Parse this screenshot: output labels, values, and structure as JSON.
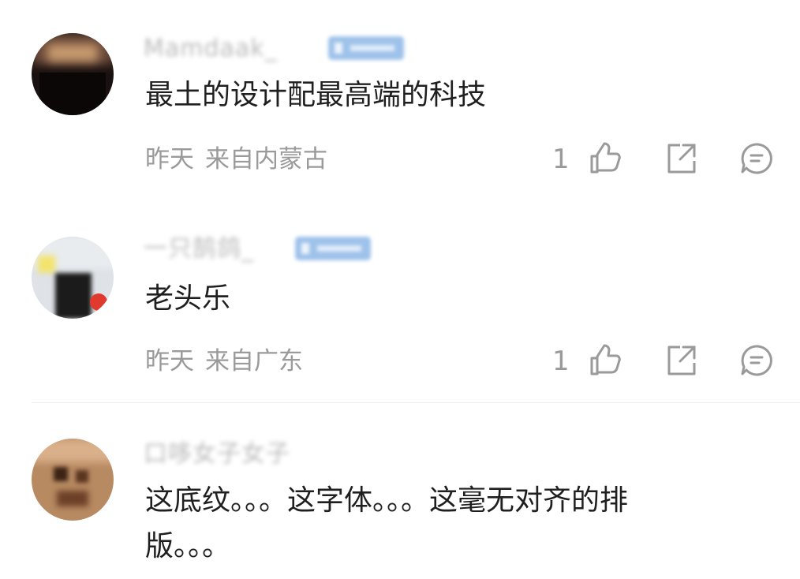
{
  "comments": [
    {
      "username": "Mamdaak_",
      "text": "最土的设计配最高端的科技",
      "time": "昨天",
      "location": "来自内蒙古",
      "likes": "1"
    },
    {
      "username": "一只鹄鸽_",
      "text": "老头乐",
      "time": "昨天",
      "location": "来自广东",
      "likes": "1"
    },
    {
      "username": "口哆女子女子",
      "text_line1": "这底纹。。。这字体。。。这毫无对齐的排",
      "text_line2": "版。。。"
    }
  ],
  "icons": {
    "like": "thumbs-up-icon",
    "share": "share-icon",
    "reply": "reply-icon"
  },
  "colors": {
    "badge": "#9ec2ea",
    "meta": "#9a9a9a",
    "text": "#1f1f1f"
  }
}
